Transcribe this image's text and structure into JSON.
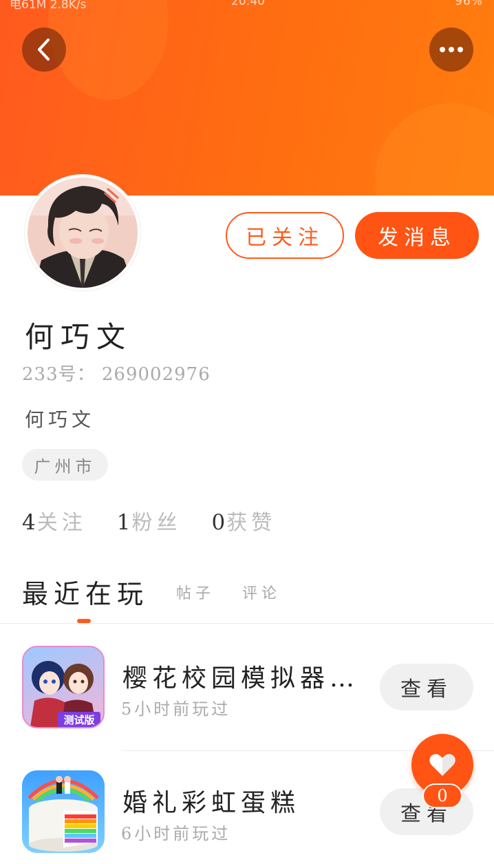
{
  "status_bar": {
    "left": "电61M 2.8K/s",
    "time": "20:40",
    "right": "96%"
  },
  "colors": {
    "accent": "#ff5414",
    "banner": "#ff6a12"
  },
  "header": {
    "back_icon": "chevron-left-icon",
    "more_icon": "more-dots-icon"
  },
  "profile": {
    "name": "何巧文",
    "id_text": "233号： 269002976",
    "bio": "何巧文",
    "location": "广州市",
    "follow_label": "已关注",
    "message_label": "发消息"
  },
  "stats": [
    {
      "count": "4",
      "label": "关注"
    },
    {
      "count": "1",
      "label": "粉丝"
    },
    {
      "count": "0",
      "label": "获赞"
    }
  ],
  "tabs": {
    "active": "最近在玩",
    "posts": "帖子",
    "comments": "评论"
  },
  "games": [
    {
      "title": "樱花校园模拟器…",
      "time": "5小时前玩过",
      "view_label": "查看",
      "badge": "测试版"
    },
    {
      "title": "婚礼彩虹蛋糕",
      "time": "6小时前玩过",
      "view_label": "查看"
    }
  ],
  "like": {
    "count": "0",
    "icon": "heart-icon"
  }
}
